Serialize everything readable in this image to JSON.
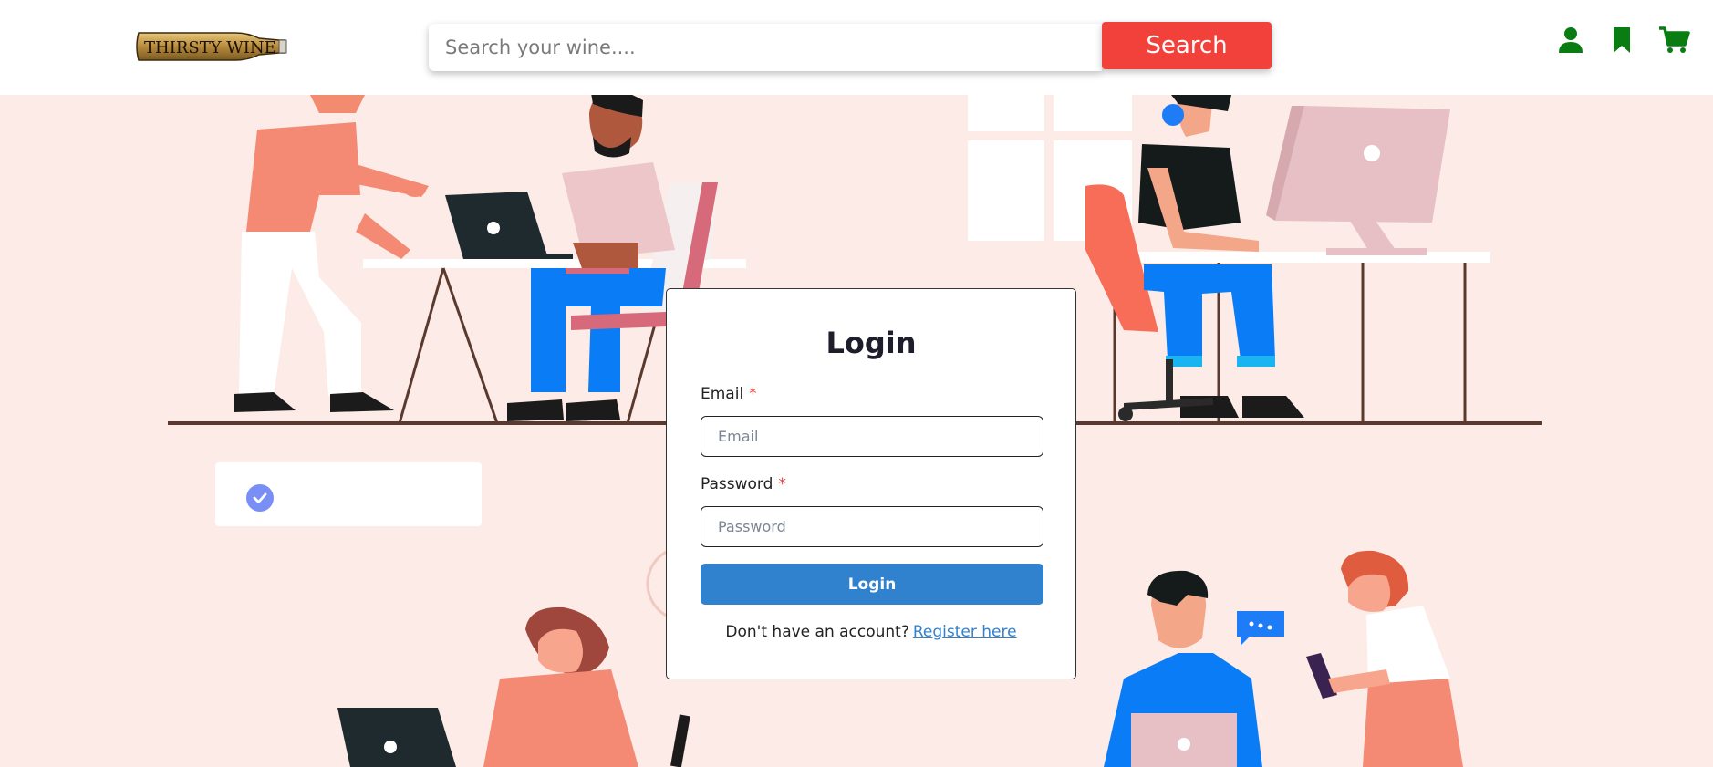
{
  "header": {
    "logo_text": "THIRSTY WINE",
    "search": {
      "placeholder": "Search your wine....",
      "value": ""
    },
    "search_button_label": "Search",
    "icons": [
      "user-icon",
      "bookmark-icon",
      "cart-icon"
    ],
    "accent_color": "#0a7d12",
    "search_button_color": "#f2413a"
  },
  "login": {
    "title": "Login",
    "email_label": "Email",
    "email_placeholder": "Email",
    "password_label": "Password",
    "password_placeholder": "Password",
    "required_mark": "*",
    "submit_label": "Login",
    "register_prompt": "Don't have an account?",
    "register_link": "Register here",
    "button_color": "#3182ce"
  },
  "toast": {
    "icon": "check-circle-icon"
  },
  "background": {
    "color": "#fcebe6"
  }
}
